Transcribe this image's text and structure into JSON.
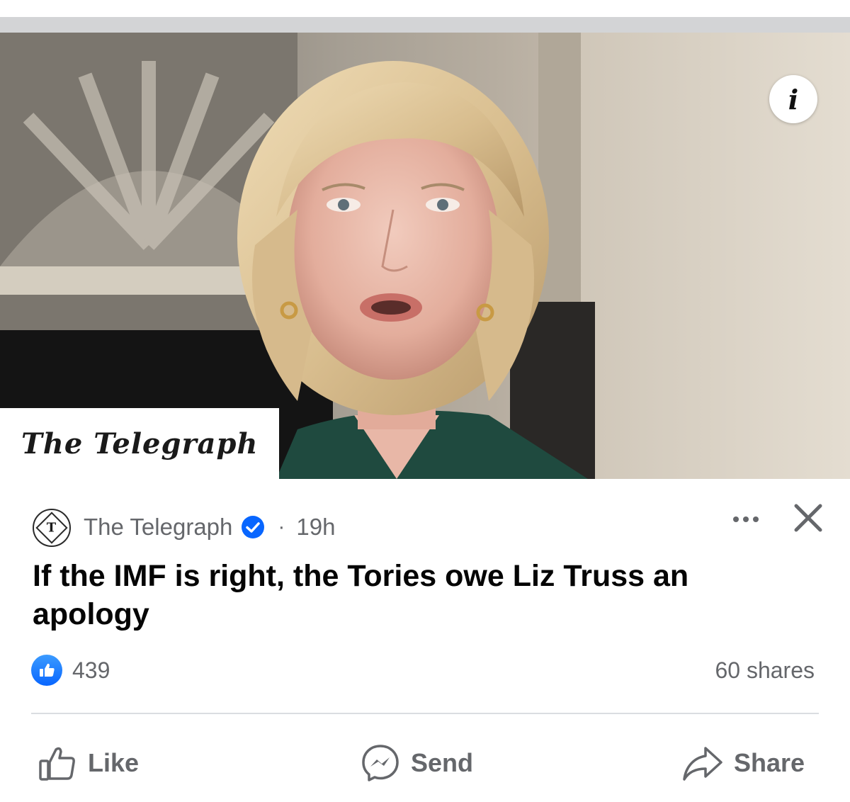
{
  "post": {
    "image": {
      "masthead": "The Telegraph",
      "info_glyph": "i"
    },
    "source": {
      "name": "The Telegraph",
      "avatar_letter": "T",
      "separator": "·",
      "time": "19h",
      "verified": true
    },
    "headline": "If the IMF is right, the Tories owe Liz Truss an apology",
    "reactions": {
      "count": "439",
      "shares": "60 shares"
    },
    "actions": {
      "like": "Like",
      "send": "Send",
      "share": "Share"
    }
  },
  "icons": {
    "info": "info-icon",
    "verified": "verified-badge-icon",
    "more": "more-options-icon",
    "close": "close-icon",
    "like_reaction": "like-reaction-icon",
    "like": "thumbs-up-icon",
    "send": "messenger-icon",
    "share": "share-arrow-icon"
  },
  "colors": {
    "facebook_blue": "#0866ff",
    "text_primary": "#050505",
    "text_secondary": "#65676b",
    "divider": "#dadde1"
  }
}
